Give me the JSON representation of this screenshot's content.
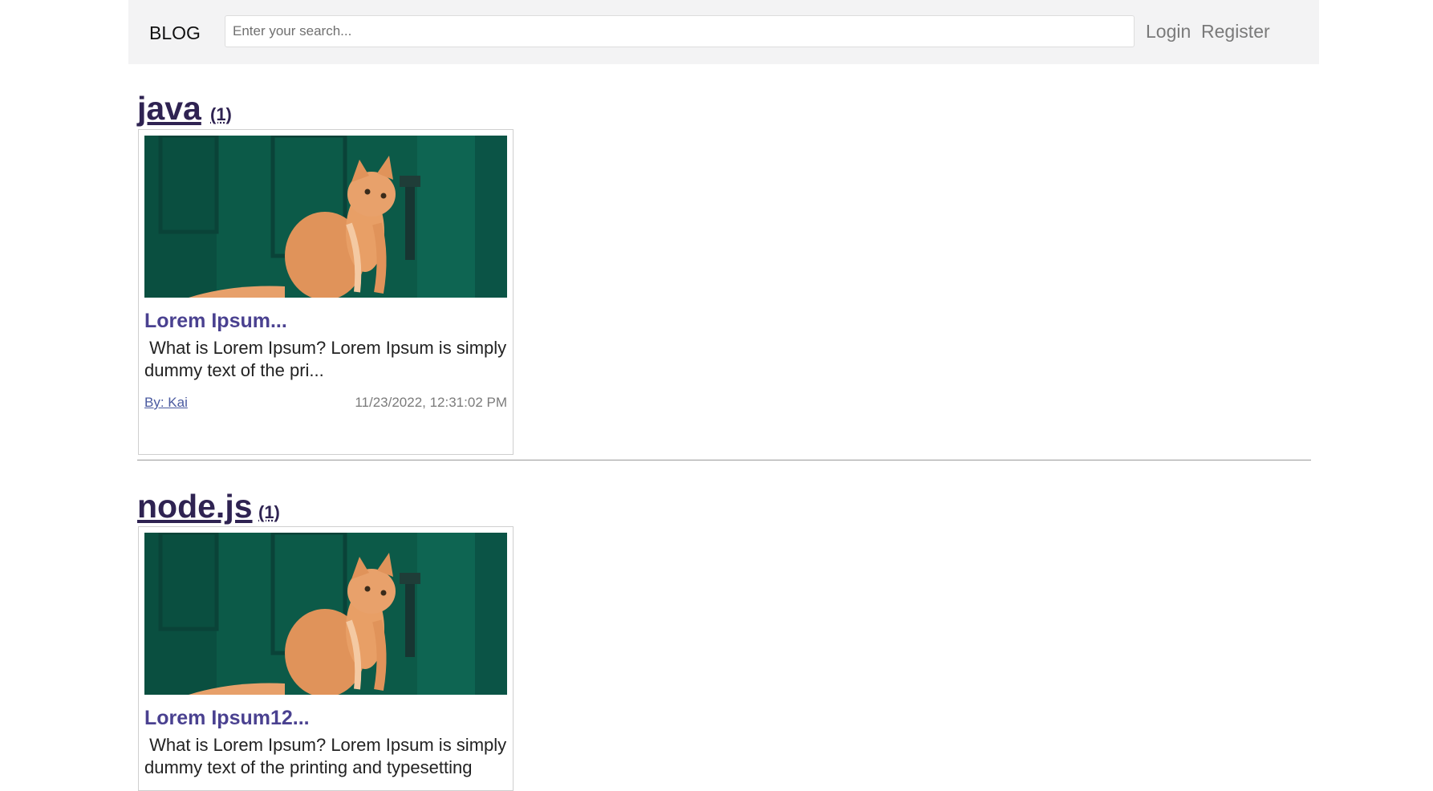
{
  "navbar": {
    "brand": "BLOG",
    "search_placeholder": "Enter your search...",
    "login": "Login",
    "register": "Register"
  },
  "sections": [
    {
      "title": "java",
      "count": "(1)",
      "post": {
        "title": "Lorem Ipsum...",
        "excerpt": " What is Lorem Ipsum? Lorem Ipsum is simply dummy text of the pri...",
        "author": "By: Kai",
        "date": "11/23/2022, 12:31:02 PM"
      }
    },
    {
      "title": "node.js",
      "count": "(1)",
      "post": {
        "title": "Lorem Ipsum12...",
        "excerpt": " What is Lorem Ipsum? Lorem Ipsum is simply dummy text of the printing and typesetting"
      }
    }
  ],
  "colors": {
    "navbar_bg": "#f3f3f4",
    "heading": "#2f2352",
    "post_title": "#4a4190",
    "door_green": "#0c5a48",
    "cat_orange": "#e0935a"
  }
}
